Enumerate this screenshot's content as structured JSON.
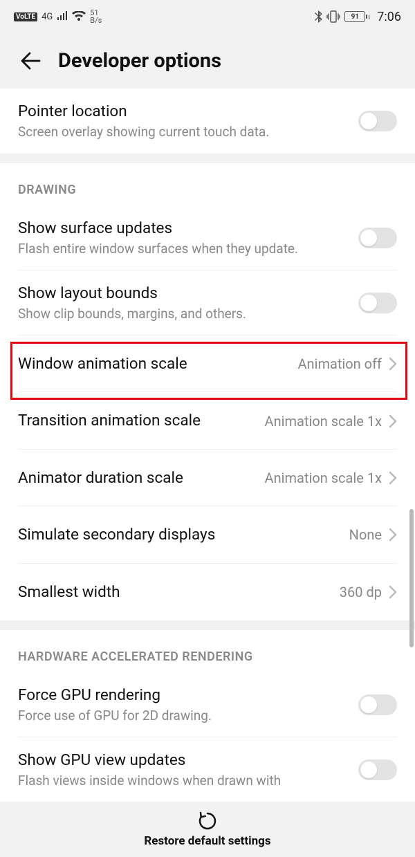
{
  "statusbar": {
    "volte": "VoLTE",
    "net_gen": "4G",
    "speed_top": "51",
    "speed_bot": "B/s",
    "battery": "91",
    "time": "7:06"
  },
  "appbar": {
    "title": "Developer options"
  },
  "rows": {
    "pointer": {
      "title": "Pointer location",
      "sub": "Screen overlay showing current touch data."
    },
    "cat_drawing": "DRAWING",
    "surface": {
      "title": "Show surface updates",
      "sub": "Flash entire window surfaces when they update."
    },
    "layout": {
      "title": "Show layout bounds",
      "sub": "Show clip bounds, margins, and others."
    },
    "winanim": {
      "title": "Window animation scale",
      "value": "Animation off"
    },
    "transanim": {
      "title": "Transition animation scale",
      "value": "Animation scale 1x"
    },
    "animdur": {
      "title": "Animator duration scale",
      "value": "Animation scale 1x"
    },
    "simdisp": {
      "title": "Simulate secondary displays",
      "value": "None"
    },
    "smallest": {
      "title": "Smallest width",
      "value": "360 dp"
    },
    "cat_hw": "HARDWARE ACCELERATED RENDERING",
    "forcegpu": {
      "title": "Force GPU rendering",
      "sub": "Force use of GPU for 2D drawing."
    },
    "gpuview": {
      "title": "Show GPU view updates",
      "sub": "Flash views inside windows when drawn with"
    }
  },
  "footer": {
    "label": "Restore default settings"
  }
}
